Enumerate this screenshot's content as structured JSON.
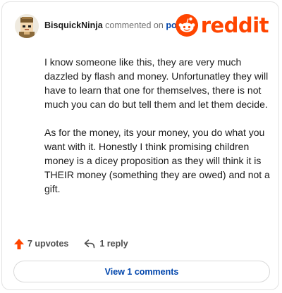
{
  "comment": {
    "author": "BisquickNinja",
    "action": "commented on",
    "target": "post",
    "paragraphs": [
      "I know someone like this, they are very much dazzled by flash and money. Unfortunatley they will have to learn that one for themselves, there is not much you can do but tell them and let them decide.",
      "As for the money, its your money, you do what you want with it. Honestly I think promising children money is a dicey proposition as they will think it is THEIR money (something they are owed) and not a gift."
    ],
    "upvotes": "7 upvotes",
    "replies": "1 reply",
    "view_button": "View 1 comments"
  },
  "brand": {
    "wordmark": "reddit",
    "color": "#ff4500"
  },
  "colors": {
    "link": "#0045ac",
    "upvote": "#ff4500",
    "muted": "#6f6f6f"
  },
  "icons": {
    "avatar": "pixel-art-avatar",
    "logo": "reddit-snoo-icon",
    "upvote": "upvote-arrow-icon",
    "reply": "reply-arrow-icon"
  }
}
